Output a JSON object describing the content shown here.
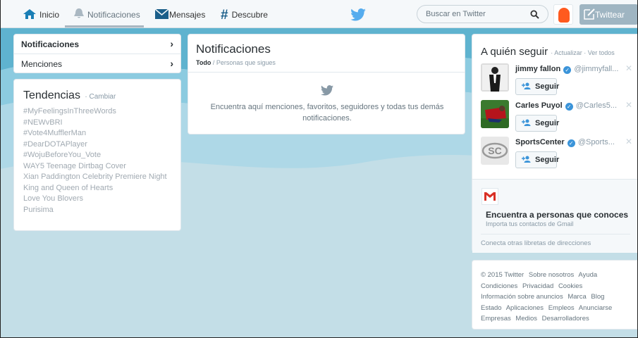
{
  "topbar": {
    "nav": [
      {
        "label": "Inicio",
        "icon": "home-icon"
      },
      {
        "label": "Notificaciones",
        "icon": "bell-icon"
      },
      {
        "label": "Mensajes",
        "icon": "envelope-icon"
      },
      {
        "label": "Descubre",
        "icon": "hashtag-icon"
      }
    ],
    "search_placeholder": "Buscar en Twitter",
    "tweet_label": "Twittear",
    "brand_color": "#55acee"
  },
  "sidebar_menu": {
    "items": [
      {
        "label": "Notificaciones",
        "chevron": "›"
      },
      {
        "label": "Menciones",
        "chevron": "›"
      }
    ]
  },
  "trends": {
    "title": "Tendencias",
    "change_label": "· Cambiar",
    "items": [
      "#MyFeelingsInThreeWords",
      "#NEWvBRI",
      "#Vote4MufflerMan",
      "#DearDOTAPlayer",
      "#WojuBeforeYou_Vote",
      "WAY5 Teenage Dirtbag Cover",
      "Xian Paddington Celebrity Premiere Night",
      "King and Queen of Hearts",
      "Love You Blovers",
      "Purisima"
    ]
  },
  "notifications": {
    "title": "Notificaciones",
    "filter_all": "Todo",
    "filter_sep": " / ",
    "filter_following": "Personas que sigues",
    "empty_line1": "Encuentra aquí menciones, favoritos, seguidores y todas tus demás",
    "empty_line2": "notificaciones."
  },
  "who_to_follow": {
    "title": "A quién seguir",
    "links": "· Actualizar · Ver todos",
    "follow_label": "Seguir",
    "close_glyph": "✕",
    "users": [
      {
        "name": "jimmy fallon",
        "handle": "@jimmyfall..."
      },
      {
        "name": "Carles Puyol",
        "handle": "@Carles5..."
      },
      {
        "name": "SportsCenter",
        "handle": "@Sports..."
      }
    ]
  },
  "gmail": {
    "title": "Encuentra a personas que conoces",
    "subtitle": "Importa tus contactos de Gmail",
    "other_link": "Conecta otras libretas de direcciones"
  },
  "footer": {
    "lines": [
      [
        "© 2015 Twitter",
        "Sobre nosotros",
        "Ayuda"
      ],
      [
        "Condiciones",
        "Privacidad",
        "Cookies"
      ],
      [
        "Información sobre anuncios",
        "Marca",
        "Blog"
      ],
      [
        "Estado",
        "Aplicaciones",
        "Empleos",
        "Anunciarse"
      ],
      [
        "Empresas",
        "Medios",
        "Desarrolladores"
      ]
    ]
  }
}
